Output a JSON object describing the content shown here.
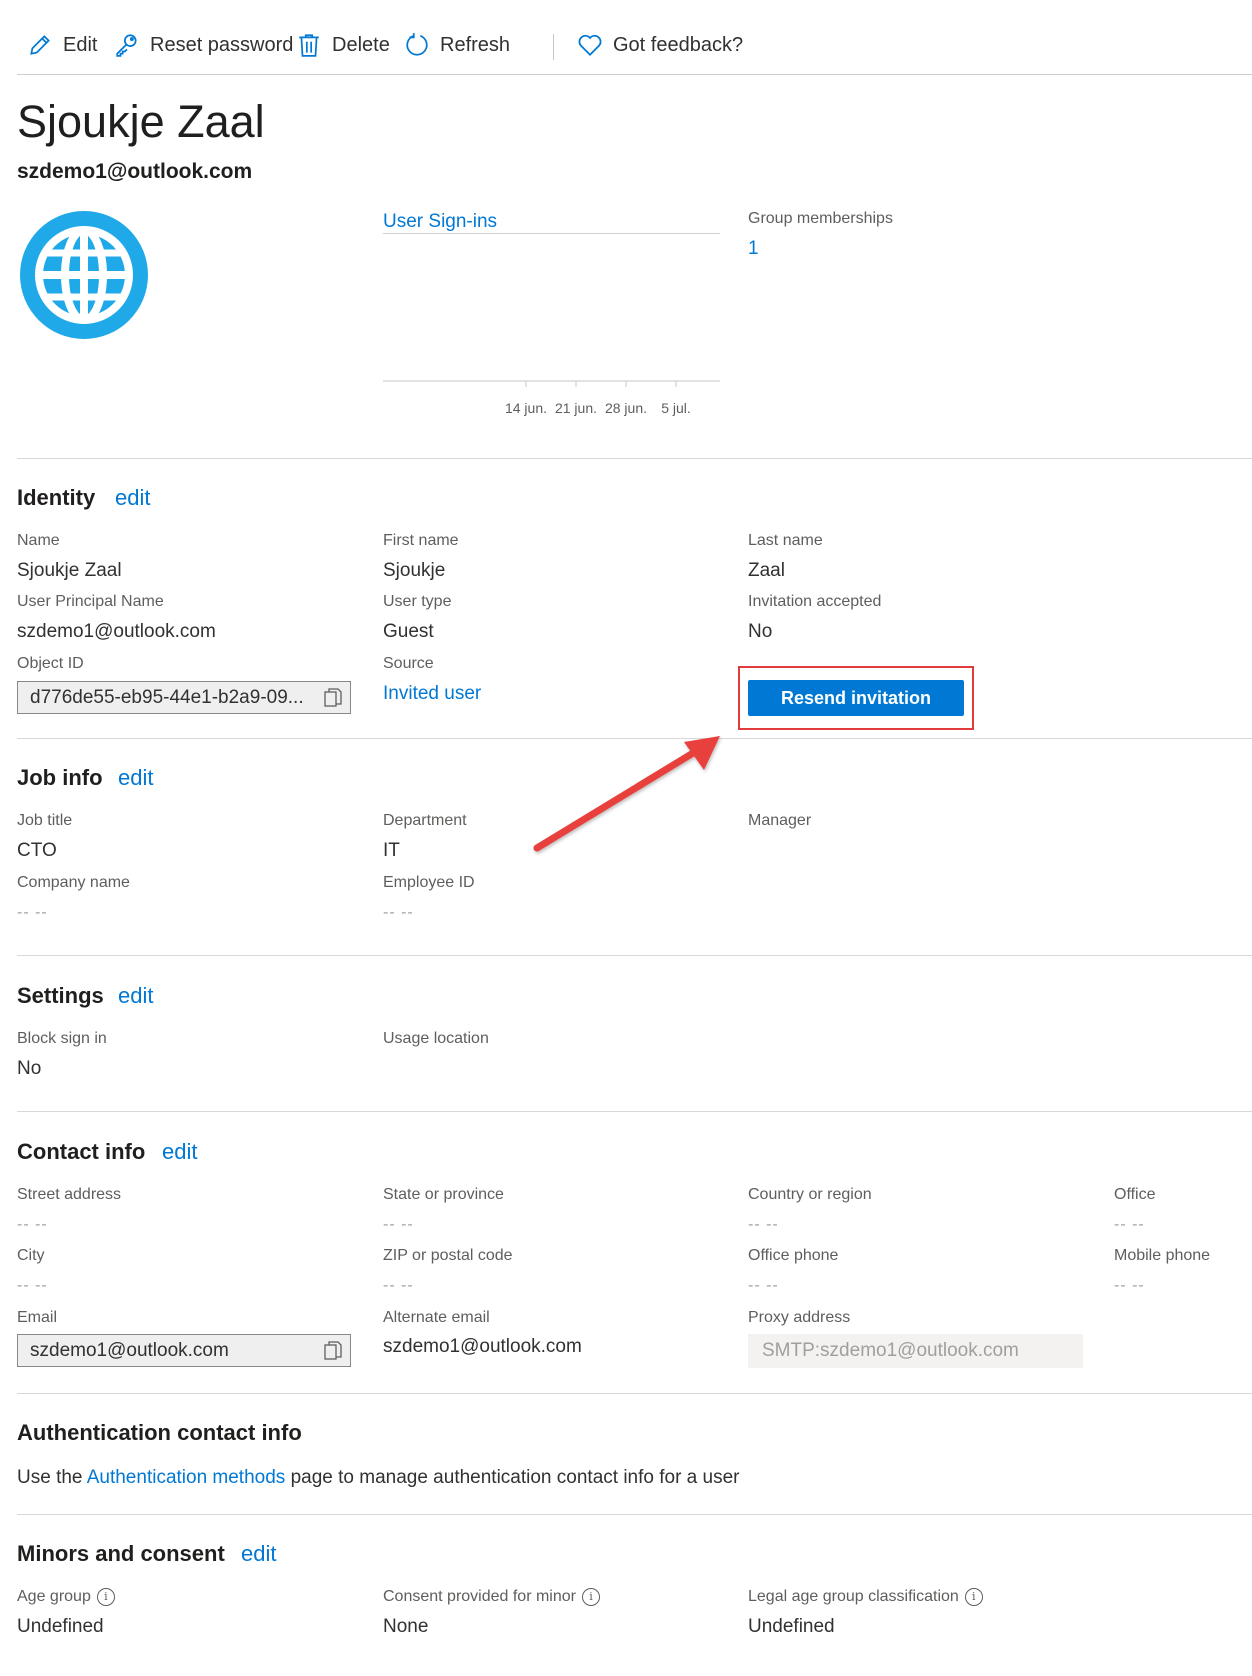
{
  "toolbar": {
    "edit": "Edit",
    "reset_password": "Reset password",
    "delete": "Delete",
    "refresh": "Refresh",
    "feedback": "Got feedback?"
  },
  "user": {
    "display_name": "Sjoukje Zaal",
    "email": "szdemo1@outlook.com"
  },
  "signins": {
    "title": "User Sign-ins",
    "ticks": [
      "14 jun.",
      "21 jun.",
      "28 jun.",
      "5 jul."
    ]
  },
  "groups": {
    "label": "Group memberships",
    "value": "1"
  },
  "identity": {
    "title": "Identity",
    "edit": "edit",
    "name_label": "Name",
    "name_value": "Sjoukje Zaal",
    "first_name_label": "First name",
    "first_name_value": "Sjoukje",
    "last_name_label": "Last name",
    "last_name_value": "Zaal",
    "upn_label": "User Principal Name",
    "upn_value": "szdemo1@outlook.com",
    "user_type_label": "User type",
    "user_type_value": "Guest",
    "invitation_label": "Invitation accepted",
    "invitation_value": "No",
    "object_id_label": "Object ID",
    "object_id_value": "d776de55-eb95-44e1-b2a9-09...",
    "source_label": "Source",
    "source_value": "Invited user",
    "resend_button": "Resend invitation"
  },
  "job": {
    "title": "Job info",
    "edit": "edit",
    "job_title_label": "Job title",
    "job_title_value": "CTO",
    "department_label": "Department",
    "department_value": "IT",
    "manager_label": "Manager",
    "company_label": "Company name",
    "company_value": "-- --",
    "employee_id_label": "Employee ID",
    "employee_id_value": "-- --"
  },
  "settings": {
    "title": "Settings",
    "edit": "edit",
    "block_label": "Block sign in",
    "block_value": "No",
    "usage_label": "Usage location"
  },
  "contact": {
    "title": "Contact info",
    "edit": "edit",
    "street_label": "Street address",
    "street_value": "-- --",
    "state_label": "State or province",
    "state_value": "-- --",
    "country_label": "Country or region",
    "country_value": "-- --",
    "office_label": "Office",
    "office_value": "-- --",
    "city_label": "City",
    "city_value": "-- --",
    "zip_label": "ZIP or postal code",
    "zip_value": "-- --",
    "office_phone_label": "Office phone",
    "office_phone_value": "-- --",
    "mobile_label": "Mobile phone",
    "mobile_value": "-- --",
    "email_label": "Email",
    "email_value": "szdemo1@outlook.com",
    "alt_email_label": "Alternate email",
    "alt_email_value": "szdemo1@outlook.com",
    "proxy_label": "Proxy address",
    "proxy_value": "SMTP:szdemo1@outlook.com"
  },
  "auth": {
    "title": "Authentication contact info",
    "text_before": "Use the ",
    "link": "Authentication methods",
    "text_after": " page to manage authentication contact info for a user"
  },
  "minors": {
    "title": "Minors and consent",
    "edit": "edit",
    "age_label": "Age group",
    "age_value": "Undefined",
    "consent_label": "Consent provided for minor",
    "consent_value": "None",
    "legal_label": "Legal age group classification",
    "legal_value": "Undefined",
    "info_glyph": "i"
  },
  "colors": {
    "accent": "#0078d4",
    "avatar": "#1fa9e8",
    "highlight": "#e23b3b"
  }
}
